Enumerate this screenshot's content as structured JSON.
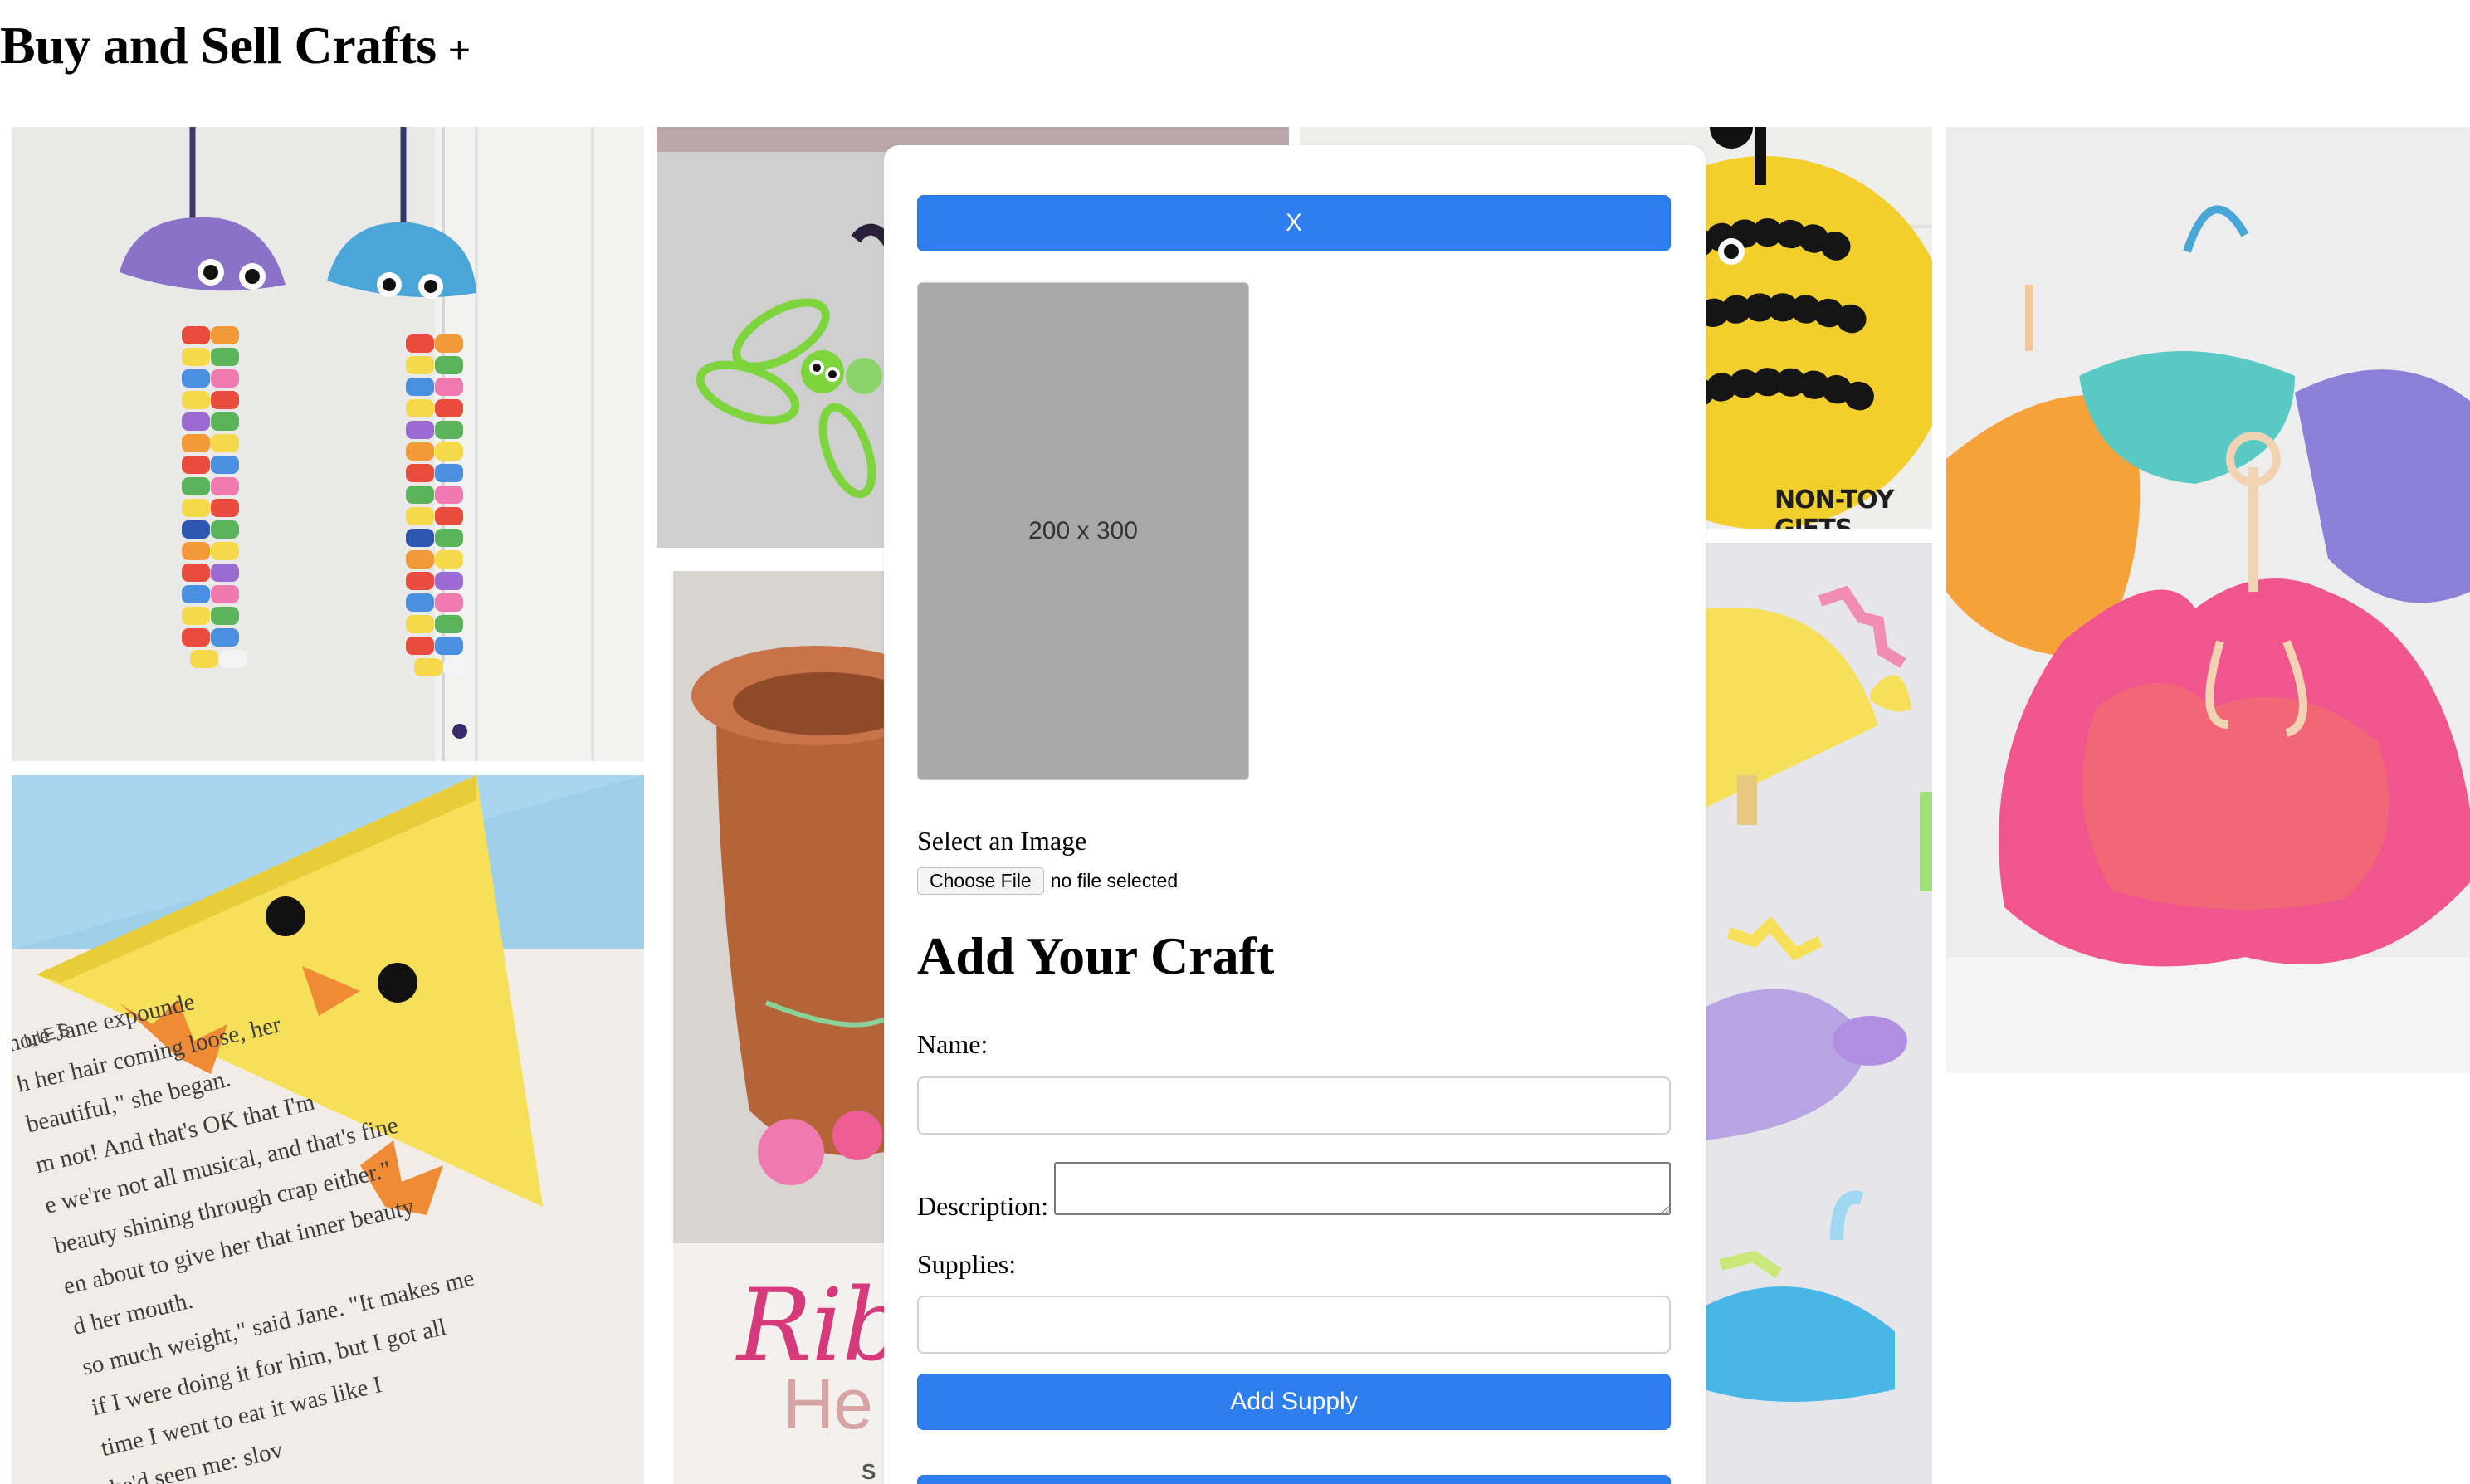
{
  "header": {
    "title": "Buy and Sell Crafts",
    "add_label": "+"
  },
  "tiles": [
    {
      "name": "jellyfish-bead-craft",
      "caption": ""
    },
    {
      "name": "pipe-cleaner-dragonfly-craft",
      "caption": ""
    },
    {
      "name": "bee-paper-plate-craft",
      "caption": "NON-TOY GIFTS"
    },
    {
      "name": "coffee-filter-dancer-craft",
      "caption": ""
    },
    {
      "name": "chick-corner-bookmark-craft",
      "caption": ""
    },
    {
      "name": "flower-pot-craft",
      "caption": "Ribb",
      "caption2": "He",
      "caption3": "S"
    },
    {
      "name": "paper-plate-dinosaur-craft",
      "caption": ""
    }
  ],
  "bookmark_text": {
    "side_label": "LIES",
    "lines": [
      "nore Jane expounde",
      "h her hair coming loose, her",
      "beautiful,\" she began.",
      "m not! And that's OK that I'm",
      "e we're not all musical, and that's fine",
      "beauty shining through crap either.\"",
      "en about to give her that inner beauty",
      "d her mouth.",
      "so much weight,\" said Jane. \"It makes me",
      "if I were doing it for him, but I got all",
      "time I went to eat it was like I",
      "he'd seen me: slov"
    ]
  },
  "modal": {
    "close_label": "X",
    "image_placeholder": "200 x 300",
    "select_image_label": "Select an Image",
    "choose_file_label": "Choose File",
    "file_status": "no file selected",
    "form_title": "Add Your Craft",
    "name_label": "Name:",
    "name_value": "",
    "description_label": "Description:",
    "description_value": "",
    "supplies_label": "Supplies:",
    "supplies_value": "",
    "add_supply_label": "Add Supply"
  },
  "colors": {
    "primary_button": "#2f7ef0",
    "placeholder_gray": "#a8a8a8"
  }
}
